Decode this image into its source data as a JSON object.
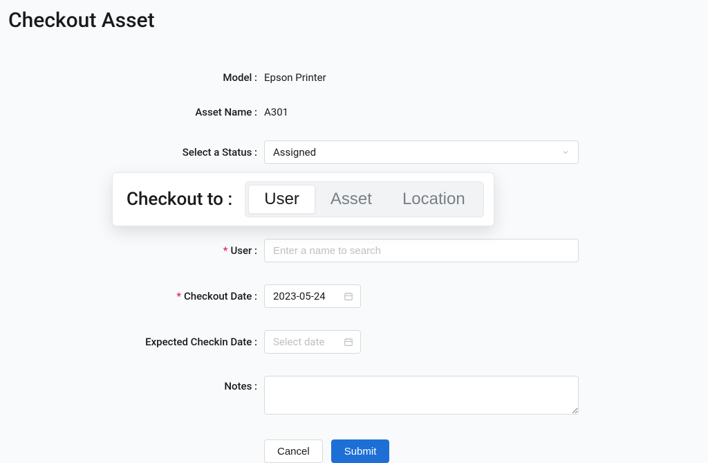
{
  "page": {
    "title": "Checkout Asset"
  },
  "form": {
    "model": {
      "label": "Model :",
      "value": "Epson Printer"
    },
    "asset_name": {
      "label": "Asset Name :",
      "value": "A301"
    },
    "status": {
      "label": "Select a Status :",
      "value": "Assigned"
    },
    "checkout_to": {
      "label": "Checkout to :",
      "options": {
        "user": "User",
        "asset": "Asset",
        "location": "Location"
      }
    },
    "user": {
      "label": "User :",
      "placeholder": "Enter a name to search"
    },
    "checkout_date": {
      "label": "Checkout Date :",
      "value": "2023-05-24"
    },
    "checkin_date": {
      "label": "Expected Checkin Date :",
      "placeholder": "Select date"
    },
    "notes": {
      "label": "Notes :"
    },
    "buttons": {
      "cancel": "Cancel",
      "submit": "Submit"
    }
  }
}
